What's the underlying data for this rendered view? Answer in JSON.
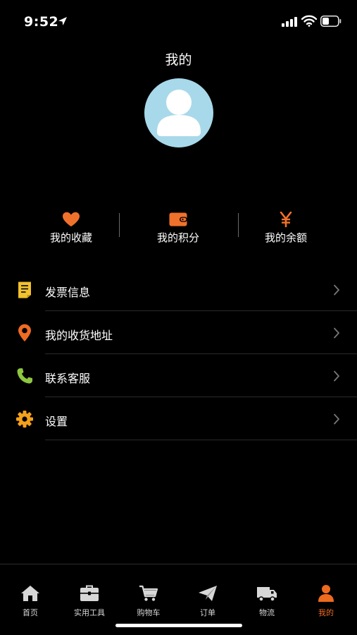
{
  "status_bar": {
    "time": "9:52"
  },
  "header": {
    "title": "我的"
  },
  "stats": [
    {
      "label": "我的收藏",
      "icon": "heart-icon"
    },
    {
      "label": "我的积分",
      "icon": "wallet-icon"
    },
    {
      "label": "我的余额",
      "icon": "yen-icon"
    }
  ],
  "menu": [
    {
      "label": "发票信息",
      "icon": "invoice-icon"
    },
    {
      "label": "我的收货地址",
      "icon": "location-pin-icon"
    },
    {
      "label": "联系客服",
      "icon": "phone-icon"
    },
    {
      "label": "设置",
      "icon": "gear-icon"
    }
  ],
  "tabs": [
    {
      "label": "首页",
      "icon": "home-icon"
    },
    {
      "label": "实用工具",
      "icon": "toolbox-icon"
    },
    {
      "label": "购物车",
      "icon": "cart-icon"
    },
    {
      "label": "订单",
      "icon": "paper-plane-icon"
    },
    {
      "label": "物流",
      "icon": "truck-icon"
    },
    {
      "label": "我的",
      "icon": "person-icon",
      "active": true
    }
  ],
  "colors": {
    "accent": "#ee6a1e",
    "heart": "#f0712c",
    "invoice": "#f2c12e",
    "location": "#ef6b22",
    "phone": "#8dc63f",
    "gear": "#f5a11b",
    "avatar_bg": "#a8d9ea"
  }
}
